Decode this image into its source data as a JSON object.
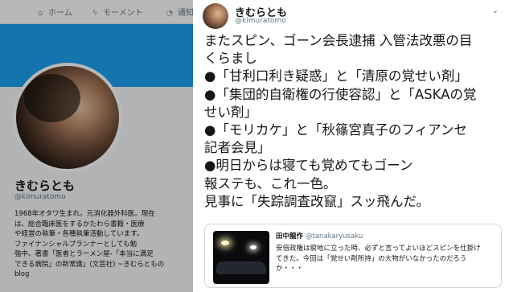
{
  "background_profile": {
    "nav": {
      "home": "ホーム",
      "moments": "モーメント",
      "notifications": "通知"
    },
    "name": "きむらとも",
    "handle": "@kimuratomo",
    "bio_lines": [
      "1968年オタワ生まれ。元消化器外科医。現在",
      "は、総合臨床医をするかたわら書籍・医療",
      "や経営の執筆・各種執筆活動しています。",
      "ファイナンシャルプランナーとしても勉",
      "強中。著書「医者とラーメン屋-「本当に満足",
      "できる病院」の新常識」(文芸社) ~きむらともの",
      "blog"
    ]
  },
  "tweet": {
    "name": "きむらとも",
    "handle": "@kimuratomo",
    "lines": [
      "またスピン、ゴーン会長逮捕 入管法改悪の目",
      "くらまし",
      "●「甘利口利き疑惑」と「清原の覚せい剤」",
      "●「集団的自衛権の行使容認」と「ASKAの覚",
      "せい剤」",
      "●「モリカケ」と「秋篠宮真子のフィアンセ",
      "記者会見」",
      "●明日からは寝ても覚めてもゴーン",
      "報ステも、これ一色。",
      "見事に「失踪調査改竄」スッ飛んだ。"
    ],
    "quote": {
      "author_name": "田中龍作",
      "author_handle": "@tanakaryusaku",
      "text_lines": [
        "安倍政権は窮地に立った時、必ずと言ってよいほどスピンを仕掛け",
        "てきた。今回は「覚せい剤所持」の大物がいなかったのだろう",
        "か・・・"
      ]
    }
  }
}
